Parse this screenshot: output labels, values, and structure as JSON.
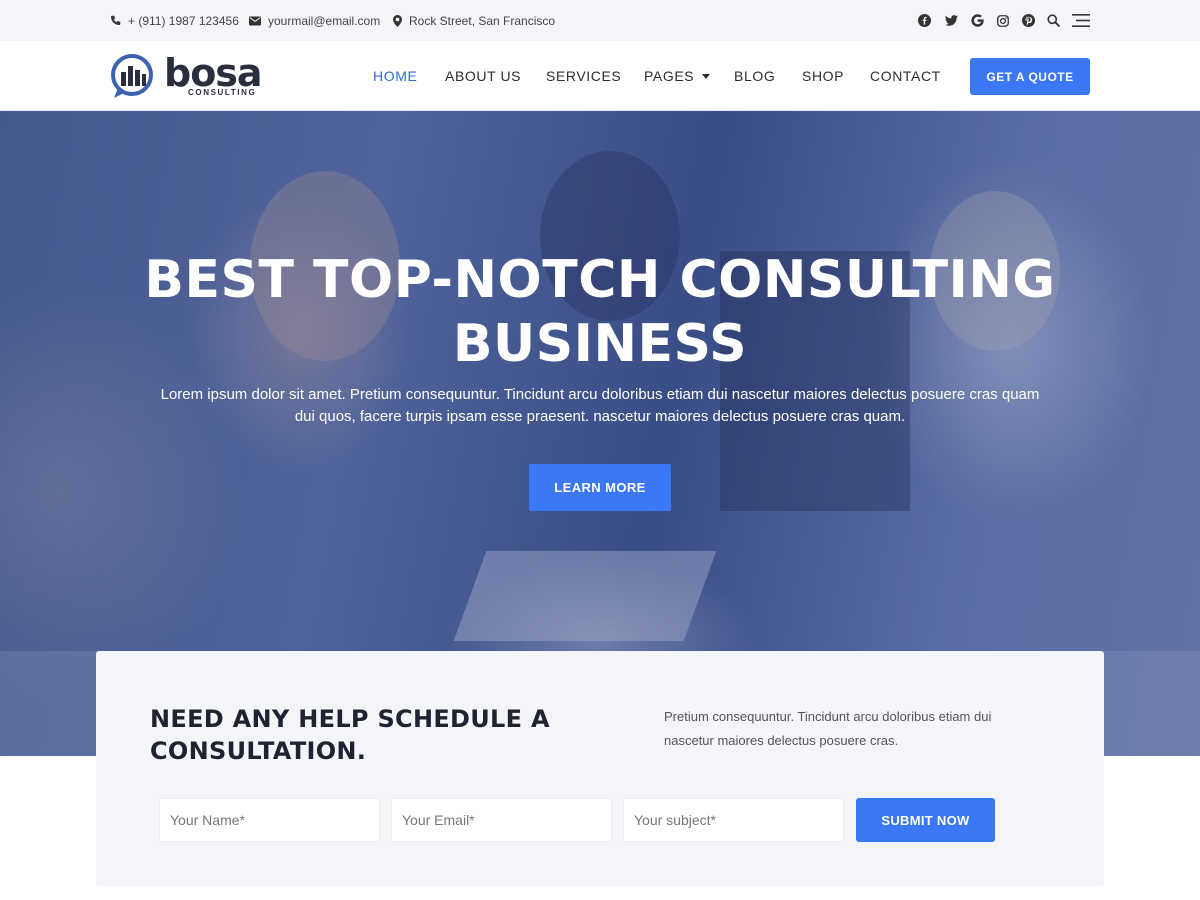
{
  "topbar": {
    "phone": "+ (911) 1987 123456",
    "email": "yourmail@email.com",
    "address": "Rock Street, San Francisco",
    "social_icons": [
      "facebook-icon",
      "twitter-icon",
      "google-icon",
      "instagram-icon",
      "pinterest-icon",
      "search-icon",
      "menu-icon"
    ]
  },
  "header": {
    "logo_word": "bosa",
    "logo_tagline": "CONSULTING",
    "nav": {
      "home": "HOME",
      "about": "ABOUT US",
      "services": "SERVICES",
      "pages": "PAGES",
      "blog": "BLOG",
      "shop": "SHOP",
      "contact": "CONTACT"
    },
    "quote_button": "GET A QUOTE"
  },
  "hero": {
    "title": "BEST TOP-NOTCH CONSULTING BUSINESS",
    "text": "Lorem ipsum dolor sit amet. Pretium consequuntur. Tincidunt arcu doloribus etiam dui nascetur maiores delectus posuere cras quam dui quos, facere turpis ipsam esse praesent. nascetur maiores delectus posuere cras quam.",
    "button": "LEARN MORE"
  },
  "consultation": {
    "title": "NEED ANY HELP SCHEDULE A CONSULTATION.",
    "text": "Pretium consequuntur. Tincidunt arcu doloribus etiam dui nascetur maiores delectus posuere cras.",
    "name_placeholder": "Your Name*",
    "email_placeholder": "Your Email*",
    "subject_placeholder": "Your subject*",
    "submit": "SUBMIT NOW"
  },
  "colors": {
    "accent": "#3b78f6",
    "active_nav": "#2e6fd1",
    "topbar_bg": "#f3f5f9",
    "heading": "#1f2230"
  }
}
